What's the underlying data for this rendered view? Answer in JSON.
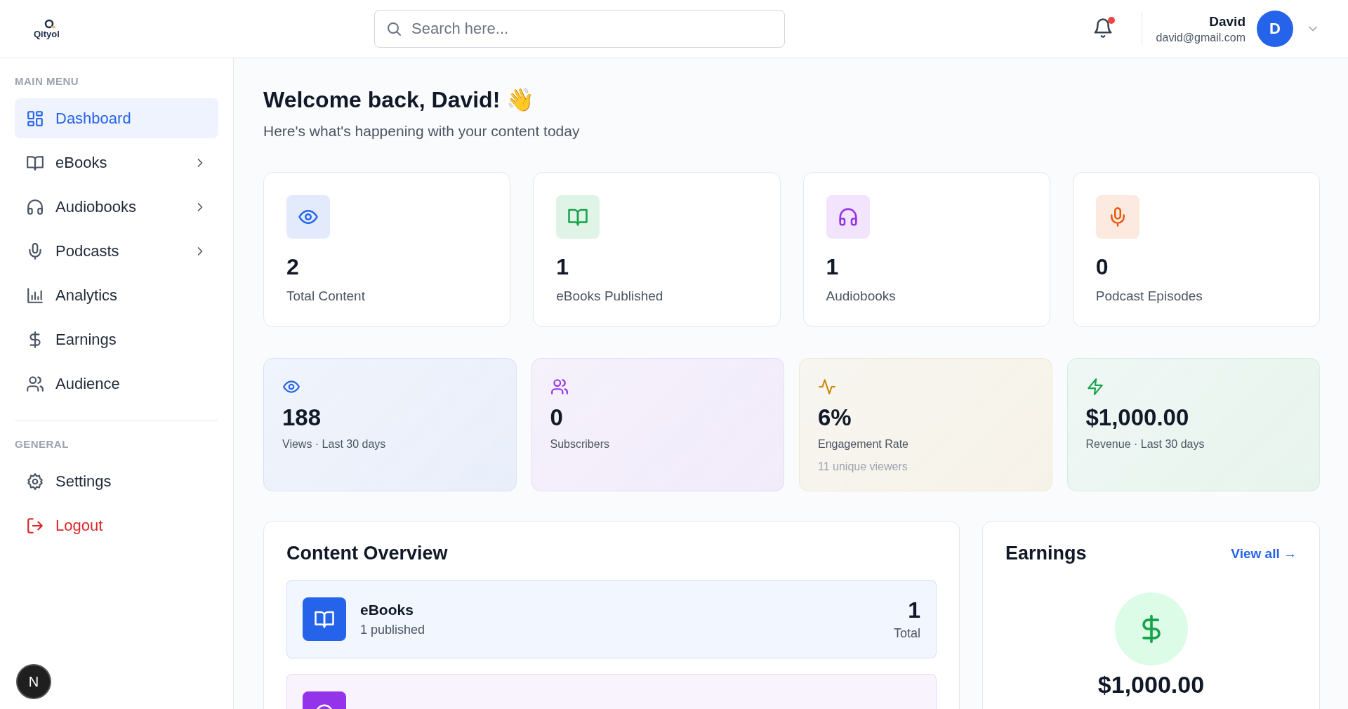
{
  "header": {
    "logo": "Qityol",
    "search": {
      "placeholder": "Search here..."
    },
    "notifications": {
      "unread": true
    },
    "user": {
      "name": "David",
      "email": "david@gmail.com",
      "initial": "D"
    }
  },
  "sidebar": {
    "sections": [
      {
        "title": "MAIN MENU",
        "items": [
          {
            "label": "Dashboard",
            "selected": true,
            "expandable": false,
            "kind": "normal"
          },
          {
            "label": "eBooks",
            "selected": false,
            "expandable": true,
            "kind": "normal"
          },
          {
            "label": "Audiobooks",
            "selected": false,
            "expandable": true,
            "kind": "normal"
          },
          {
            "label": "Podcasts",
            "selected": false,
            "expandable": true,
            "kind": "normal"
          },
          {
            "label": "Analytics",
            "selected": false,
            "expandable": false,
            "kind": "normal"
          },
          {
            "label": "Earnings",
            "selected": false,
            "expandable": false,
            "kind": "normal"
          },
          {
            "label": "Audience",
            "selected": false,
            "expandable": false,
            "kind": "normal"
          }
        ]
      },
      {
        "title": "GENERAL",
        "items": [
          {
            "label": "Settings",
            "selected": false,
            "expandable": false,
            "kind": "normal"
          },
          {
            "label": "Logout",
            "selected": false,
            "expandable": false,
            "kind": "danger"
          }
        ]
      }
    ],
    "footer_badge": "N"
  },
  "welcome": {
    "title": "Welcome back, David! 👋",
    "subtitle": "Here's what's happening with your content today"
  },
  "stat_cards": [
    {
      "value": "2",
      "label": "Total Content",
      "color": "#2563eb"
    },
    {
      "value": "1",
      "label": "eBooks Published",
      "color": "#16a34a"
    },
    {
      "value": "1",
      "label": "Audiobooks",
      "color": "#9333ea"
    },
    {
      "value": "0",
      "label": "Podcast Episodes",
      "color": "#ea580c"
    }
  ],
  "metric_cards": [
    {
      "value": "188",
      "label": "Views · Last 30 days",
      "color": "#2563eb"
    },
    {
      "value": "0",
      "label": "Subscribers",
      "color": "#9333ea"
    },
    {
      "value": "6%",
      "label": "Engagement Rate",
      "note": "11 unique viewers",
      "color": "#ca8a04"
    },
    {
      "value": "$1,000.00",
      "label": "Revenue · Last 30 days",
      "color": "#16a34a"
    }
  ],
  "content_overview": {
    "title": "Content Overview",
    "rows": [
      {
        "title": "eBooks",
        "subtitle": "1 published",
        "count": "1",
        "count_label": "Total",
        "color": "#2563eb"
      },
      {
        "color": "#9333ea"
      }
    ]
  },
  "earnings": {
    "title": "Earnings",
    "link": "View all →",
    "amount": "$1,000.00"
  }
}
